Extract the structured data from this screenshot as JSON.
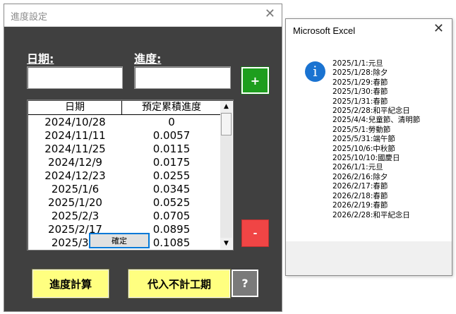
{
  "form": {
    "title": "進度設定",
    "close_glyph": "✕",
    "date_label": "日期:",
    "progress_label": "進度:",
    "date_value": "",
    "progress_value": "",
    "add_label": "+",
    "delete_label": "-",
    "calc_label": "進度計算",
    "holiday_label": "代入不計工期",
    "help_label": "?",
    "list": {
      "headers": [
        "日期",
        "預定累積進度"
      ],
      "rows": [
        [
          "2024/10/28",
          "0"
        ],
        [
          "2024/11/11",
          "0.0057"
        ],
        [
          "2024/11/25",
          "0.0115"
        ],
        [
          "2024/12/9",
          "0.0175"
        ],
        [
          "2024/12/23",
          "0.0255"
        ],
        [
          "2025/1/6",
          "0.0345"
        ],
        [
          "2025/1/20",
          "0.0525"
        ],
        [
          "2025/2/3",
          "0.0705"
        ],
        [
          "2025/2/17",
          "0.0895"
        ],
        [
          "2025/3/3",
          "0.1085"
        ]
      ],
      "scroll_up": "▲",
      "scroll_down": "▼"
    }
  },
  "msgbox": {
    "title": "Microsoft Excel",
    "close_glyph": "✕",
    "icon": "info-icon",
    "icon_glyph": "i",
    "lines": [
      "2025/1/1:元旦",
      "2025/1/28:除夕",
      "2025/1/29:春節",
      "2025/1/30:春節",
      "2025/1/31:春節",
      "2025/2/28:和平紀念日",
      "2025/4/4:兒童節、清明節",
      "2025/5/1:勞動節",
      "2025/5/31:端午節",
      "2025/10/6:中秋節",
      "2025/10/10:國慶日",
      "2026/1/1:元旦",
      "2026/2/16:除夕",
      "2026/2/17:春節",
      "2026/2/18:春節",
      "2026/2/19:春節",
      "2026/2/28:和平紀念日"
    ],
    "ok_label": "確定"
  },
  "colors": {
    "form_bg": "#404040",
    "add_button": "#1e9e1e",
    "delete_button": "#f04545",
    "action_button": "#ffff80",
    "help_button": "#7a7a7a",
    "info_icon": "#1a73d1"
  }
}
